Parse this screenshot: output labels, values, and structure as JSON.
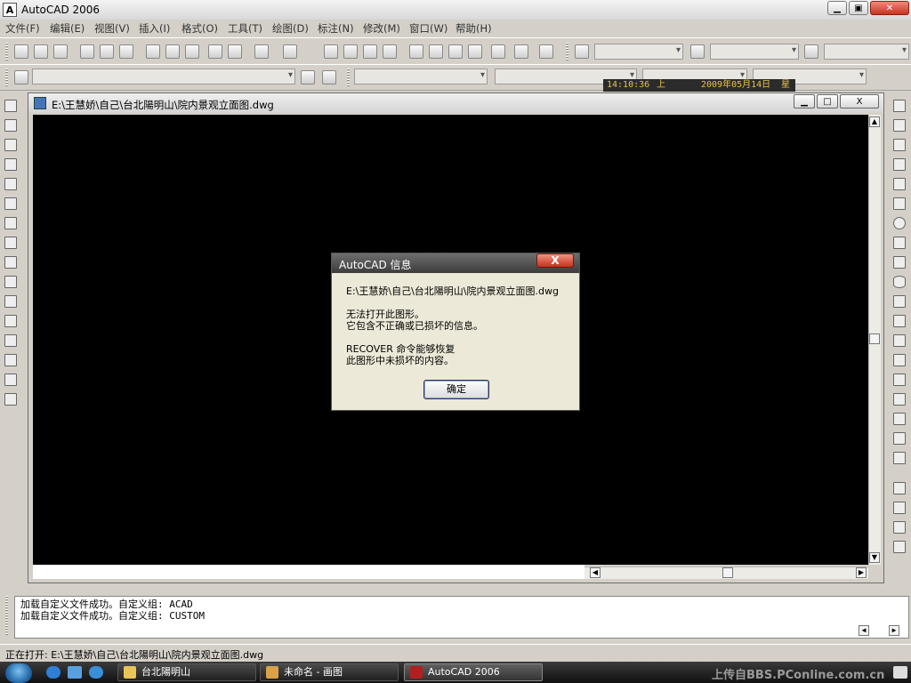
{
  "app": {
    "title": "AutoCAD 2006",
    "icon_letter": "A"
  },
  "window_buttons": {
    "minimize": "▁",
    "maximize": "▣",
    "close": "✕"
  },
  "menu": [
    "文件(F)",
    "编辑(E)",
    "视图(V)",
    "插入(I)",
    "格式(O)",
    "工具(T)",
    "绘图(D)",
    "标注(N)",
    "修改(M)",
    "窗口(W)",
    "帮助(H)"
  ],
  "clock": {
    "time": "14:10:36",
    "t_suffix": "上",
    "date": "2009年05月14日",
    "d_suffix": "星"
  },
  "drawing_window": {
    "title": "E:\\王慧娇\\自己\\台北陽明山\\院内景观立面图.dwg",
    "buttons": {
      "minimize": "▁",
      "maximize": "□",
      "close": "X"
    }
  },
  "dialog": {
    "title": "AutoCAD 信息",
    "close": "X",
    "path": "E:\\王慧娇\\自己\\台北陽明山\\院内景观立面图.dwg",
    "msg1": "无法打开此图形。",
    "msg2": "它包含不正确或已损坏的信息。",
    "msg3": "RECOVER 命令能够恢复",
    "msg4": "此图形中未损坏的内容。",
    "ok": "确定"
  },
  "command": {
    "line1": "加载自定义文件成功。自定义组: ACAD",
    "line2": "加载自定义文件成功。自定义组: CUSTOM"
  },
  "status": "正在打开: E:\\王慧娇\\自己\\台北陽明山\\院内景观立面图.dwg",
  "taskbar": {
    "tasks": [
      {
        "label": "台北陽明山"
      },
      {
        "label": "未命名 - 画图"
      },
      {
        "label": "AutoCAD 2006"
      }
    ],
    "watermark": "上传自BBS.PConline.com.cn"
  },
  "colors": {
    "canvas": "#000000",
    "clock_text": "#e8c24a",
    "close_red": "#c4301c"
  }
}
